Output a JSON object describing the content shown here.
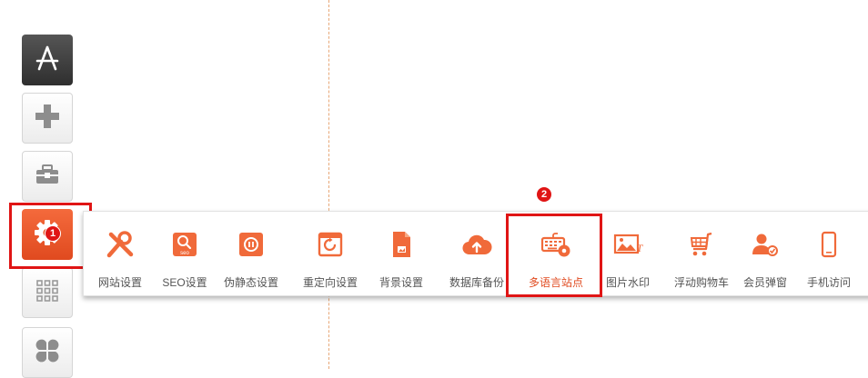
{
  "sidebar": {
    "items": [
      {
        "name": "app-store"
      },
      {
        "name": "add"
      },
      {
        "name": "toolbox"
      },
      {
        "name": "settings",
        "badge": "1"
      },
      {
        "name": "apps-grid"
      },
      {
        "name": "modules"
      }
    ]
  },
  "toolbar": {
    "items": [
      {
        "label": "网站设置",
        "icon": "tools-icon"
      },
      {
        "label": "SEO设置",
        "icon": "seo-icon"
      },
      {
        "label": "伪静态设置",
        "icon": "pseudo-static-icon"
      },
      {
        "label": "重定向设置",
        "icon": "redirect-icon"
      },
      {
        "label": "背景设置",
        "icon": "background-icon"
      },
      {
        "label": "数据库备份",
        "icon": "cloud-upload-icon"
      },
      {
        "label": "多语言站点",
        "icon": "keyboard-gear-icon",
        "badge": "2"
      },
      {
        "label": "图片水印",
        "icon": "image-watermark-icon"
      },
      {
        "label": "浮动购物车",
        "icon": "shopping-cart-icon"
      },
      {
        "label": "会员弹窗",
        "icon": "member-popup-icon"
      },
      {
        "label": "手机访问",
        "icon": "mobile-icon"
      }
    ]
  },
  "colors": {
    "accent": "#e04a1f",
    "highlight": "#e01515",
    "icon": "#f06a3a"
  }
}
